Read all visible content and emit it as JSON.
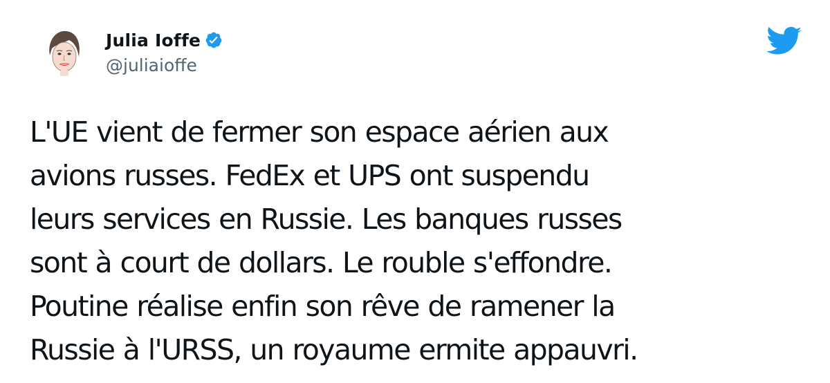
{
  "author": {
    "display_name": "Julia Ioffe",
    "handle": "@juliaioffe",
    "verified": true,
    "avatar_icon": "avatar-illustration"
  },
  "tweet": {
    "lines": [
      "L'UE vient de fermer son espace aérien aux",
      "avions russes. FedEx et UPS ont suspendu",
      "leurs services en Russie. Les banques russes",
      "sont à court de dollars. Le rouble s'effondre.",
      "Poutine réalise enfin son rêve de ramener la",
      "Russie à l'URSS, un royaume ermite appauvri."
    ]
  },
  "brand": {
    "logo_icon": "twitter-bird-icon",
    "accent_color": "#1d9bf0"
  }
}
